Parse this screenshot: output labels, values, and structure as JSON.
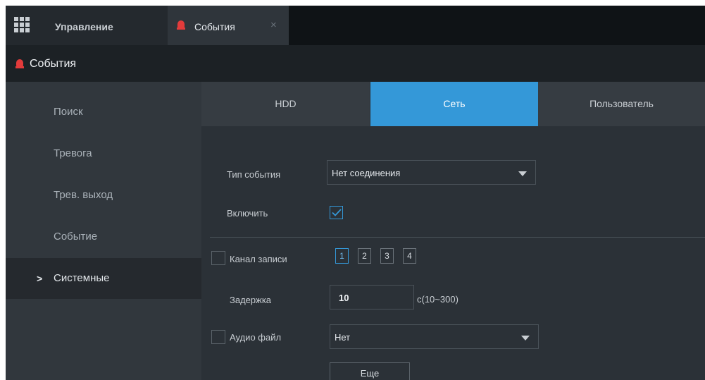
{
  "tabs": {
    "manage_label": "Управление",
    "events_label": "События",
    "close_glyph": "×"
  },
  "header": {
    "title": "События"
  },
  "sidebar": {
    "items": [
      {
        "label": "Поиск"
      },
      {
        "label": "Тревога"
      },
      {
        "label": "Трев. выход"
      },
      {
        "label": "Событие"
      },
      {
        "label": "Системные",
        "active": true
      }
    ],
    "active_marker": ">"
  },
  "content": {
    "tabs": [
      {
        "label": "HDD",
        "active": false
      },
      {
        "label": "Сеть",
        "active": true
      },
      {
        "label": "Пользователь",
        "active": false
      }
    ],
    "form": {
      "event_type_label": "Тип события",
      "event_type_value": "Нет соединения",
      "enable_label": "Включить",
      "enable_checked": true,
      "record_channel_label": "Канал записи",
      "record_channel_checked": false,
      "channels": [
        "1",
        "2",
        "3",
        "4"
      ],
      "selected_channel": "1",
      "delay_label": "Задержка",
      "delay_value": "10",
      "delay_unit": "с(10~300)",
      "audio_label": "Аудио файл",
      "audio_checked": false,
      "audio_value": "Нет",
      "more_button": "Еще"
    }
  },
  "colors": {
    "accent": "#3498d8",
    "alarm": "#e23b3b",
    "background": "#2b3036"
  }
}
